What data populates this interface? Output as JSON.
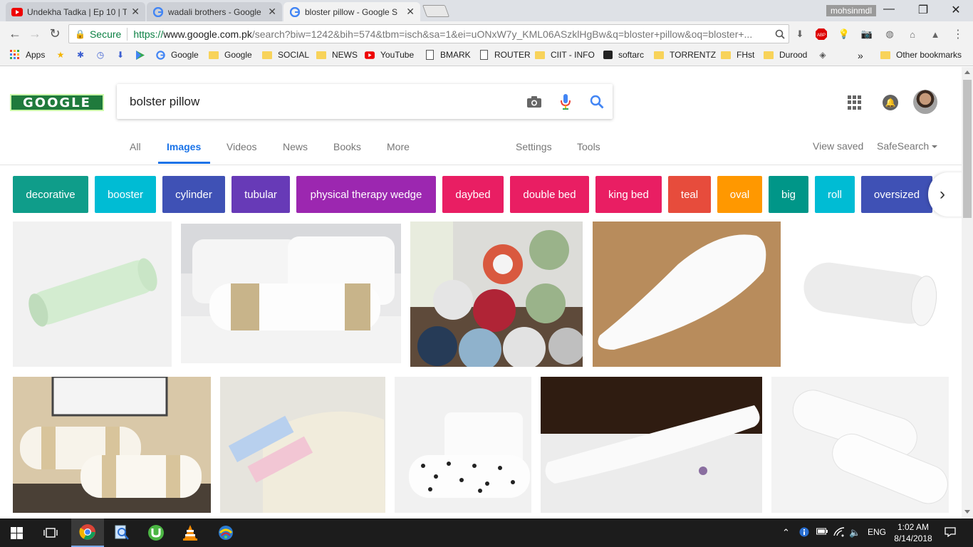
{
  "browser": {
    "tabs": [
      {
        "title": "Undekha Tadka | Ep 10 | T",
        "active": false,
        "icon": "youtube-icon"
      },
      {
        "title": "wadali brothers - Google",
        "active": false,
        "icon": "google-icon"
      },
      {
        "title": "bloster pillow - Google S",
        "active": true,
        "icon": "google-icon"
      }
    ],
    "profile_name": "mohsinmdl",
    "address": {
      "secure_label": "Secure",
      "scheme": "https://",
      "host": "www.google.com.pk",
      "path": "/search?biw=1242&bih=574&tbm=isch&sa=1&ei=uONxW7y_KML06ASzklHgBw&q=bloster+pillow&oq=bloster+..."
    },
    "extensions": [
      "download-icon",
      "adblock-icon",
      "idea-icon",
      "camera-icon",
      "globe-icon",
      "puzzle-icon",
      "drive-icon"
    ],
    "extension_abp_label": "ABP",
    "bookmarks": [
      {
        "label": "Apps",
        "icon": "apps-icon"
      },
      {
        "label": "",
        "icon": "star-icon"
      },
      {
        "label": "",
        "icon": "puzzle-icon"
      },
      {
        "label": "",
        "icon": "history-icon"
      },
      {
        "label": "",
        "icon": "download-icon"
      },
      {
        "label": "",
        "icon": "play-icon"
      },
      {
        "label": "Google",
        "icon": "google-icon"
      },
      {
        "label": "Google",
        "icon": "folder-icon"
      },
      {
        "label": "SOCIAL",
        "icon": "folder-icon"
      },
      {
        "label": "NEWS",
        "icon": "folder-icon"
      },
      {
        "label": "YouTube",
        "icon": "youtube-icon"
      },
      {
        "label": "BMARK",
        "icon": "page-icon"
      },
      {
        "label": "ROUTER",
        "icon": "page-icon"
      },
      {
        "label": "CIIT - INFO",
        "icon": "folder-icon"
      },
      {
        "label": "softarc",
        "icon": "terminal-icon"
      },
      {
        "label": "TORRENTZ",
        "icon": "folder-icon"
      },
      {
        "label": "FHst",
        "icon": "folder-icon"
      },
      {
        "label": "Durood",
        "icon": "folder-icon"
      },
      {
        "label": "",
        "icon": "diamond-icon"
      }
    ],
    "bookmarks_overflow": "»",
    "other_bookmarks": "Other bookmarks"
  },
  "google": {
    "logo_text": "GOOGLE",
    "query": "bolster pillow",
    "tabs": [
      "All",
      "Images",
      "Videos",
      "News",
      "Books",
      "More"
    ],
    "active_tab": "Images",
    "settings": "Settings",
    "tools": "Tools",
    "view_saved": "View saved",
    "safesearch": "SafeSearch",
    "chips": [
      {
        "label": "decorative",
        "color": "#0f9d8a"
      },
      {
        "label": "booster",
        "color": "#00bcd4"
      },
      {
        "label": "cylinder",
        "color": "#3f51b5"
      },
      {
        "label": "tubular",
        "color": "#673ab7"
      },
      {
        "label": "physical therapy wedge",
        "color": "#9c27b0"
      },
      {
        "label": "daybed",
        "color": "#e91e63"
      },
      {
        "label": "double bed",
        "color": "#e91e63"
      },
      {
        "label": "king bed",
        "color": "#e91e63"
      },
      {
        "label": "teal",
        "color": "#e74c3c"
      },
      {
        "label": "oval",
        "color": "#ff9800"
      },
      {
        "label": "big",
        "color": "#009688"
      },
      {
        "label": "roll",
        "color": "#00bcd4"
      },
      {
        "label": "oversized",
        "color": "#3f51b5"
      }
    ]
  },
  "taskbar": {
    "time": "1:02 AM",
    "date": "8/14/2018",
    "language": "ENG",
    "apps": [
      "chrome-icon",
      "search-icon",
      "utorrent-icon",
      "vlc-icon",
      "network-globe-icon"
    ]
  }
}
